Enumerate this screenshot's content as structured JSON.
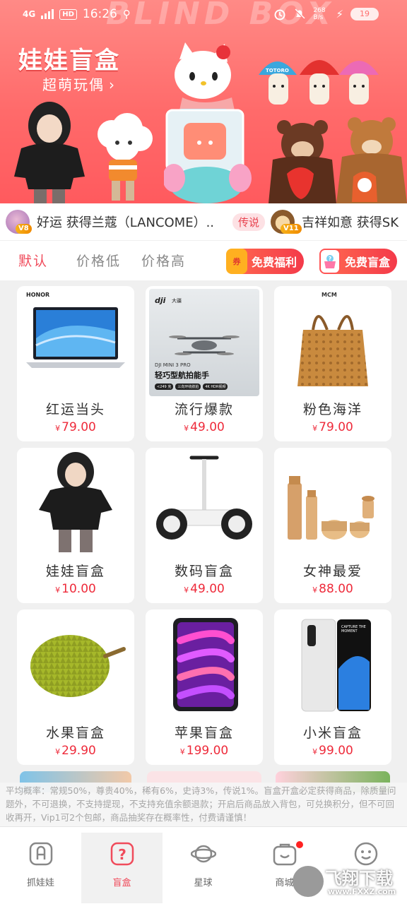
{
  "status_bar": {
    "network": "4G",
    "hd": "HD",
    "time": "16:26",
    "speed": "268 B/s",
    "battery": "19"
  },
  "banner": {
    "watermark": "BLIND BOX",
    "title": "娃娃盲盒",
    "subtitle": "超萌玩偶",
    "chevron": "›",
    "mushroom_label": "TOTORO"
  },
  "ticker": {
    "items": [
      {
        "badge": "V8",
        "text": "好运 获得兰蔻（LANCOME）.."
      },
      {
        "rarity": "传说",
        "badge": "V11",
        "text": "吉祥如意 获得SK"
      }
    ]
  },
  "sort_bar": {
    "tabs": [
      "默认",
      "价格低",
      "价格高"
    ],
    "welfare_label": "免费福利",
    "welfare_icon_text": "券",
    "free_box_label": "免费盲盒"
  },
  "products": [
    {
      "name": "红运当头",
      "price": "79.00",
      "brand": "HONOR"
    },
    {
      "name": "流行爆款",
      "price": "49.00",
      "brand": "dji",
      "brand_sub": "大疆",
      "model": "DJI MINI 3 PRO",
      "headline": "轻巧型航拍能手",
      "chips": [
        "<249 克",
        "三向环绕航拍",
        "4K HDR视频"
      ]
    },
    {
      "name": "粉色海洋",
      "price": "79.00",
      "brand": "MCM"
    },
    {
      "name": "娃娃盲盒",
      "price": "10.00"
    },
    {
      "name": "数码盲盒",
      "price": "49.00"
    },
    {
      "name": "女神最爱",
      "price": "88.00"
    },
    {
      "name": "水果盲盒",
      "price": "29.90"
    },
    {
      "name": "苹果盲盒",
      "price": "199.00"
    },
    {
      "name": "小米盲盒",
      "price": "99.00",
      "phone_text": "CAPTURE THE MOMENT"
    }
  ],
  "currency": "¥",
  "notice": "平均概率：常规50%，尊贵40%，稀有6%，史诗3%，传说1%。盲盒开盒必定获得商品，除质量问题外，不可退换，不支持提现，不支持充值余额退款；开启后商品放入背包，可兑换积分，但不可回收再开，Vip1可2个包邮，商品抽奖存在概率性，付费请谨慎！",
  "nav": [
    {
      "label": "抓娃娃"
    },
    {
      "label": "盲盒"
    },
    {
      "label": "星球"
    },
    {
      "label": "商城"
    },
    {
      "label": ""
    }
  ],
  "watermark": {
    "text": "飞翔下载",
    "url": "www.FXXZ.com"
  },
  "colors": {
    "accent": "#f04b5b",
    "price": "#ee2a3a",
    "banner": "#ff6a6a"
  }
}
